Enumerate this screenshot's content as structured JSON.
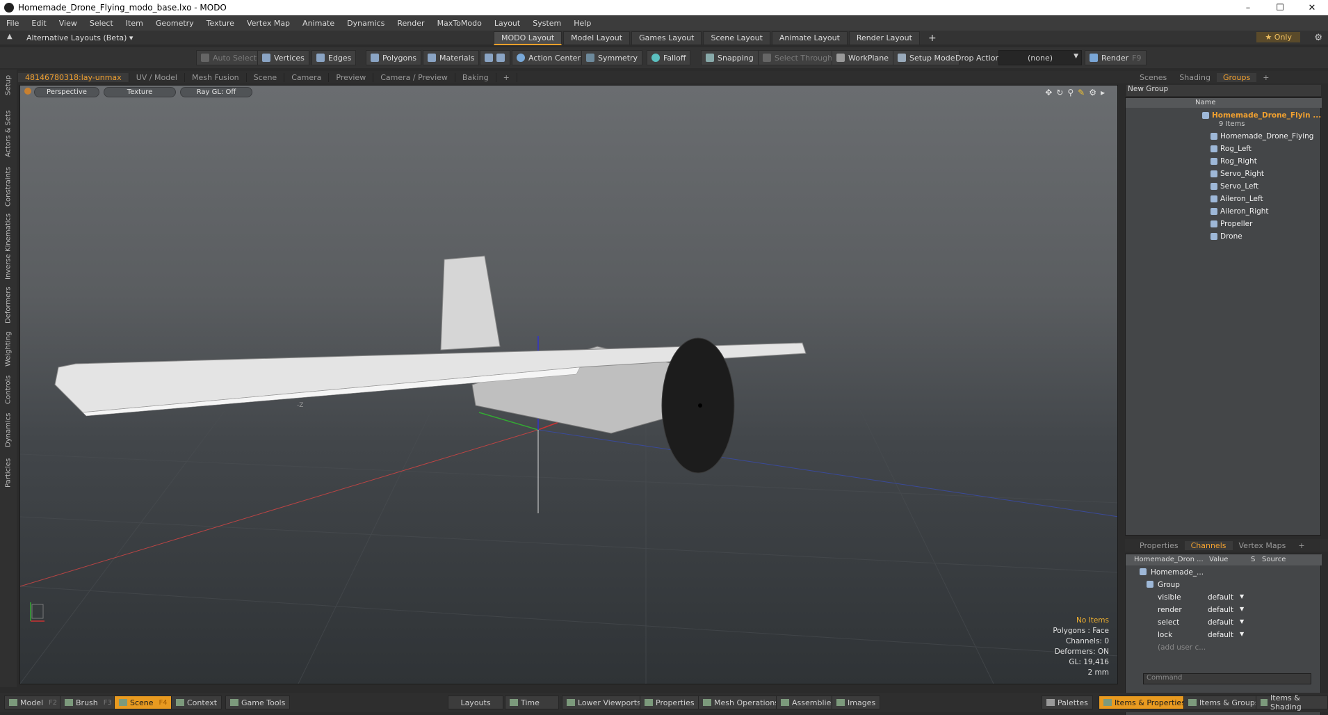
{
  "window": {
    "title": "Homemade_Drone_Flying_modo_base.lxo - MODO",
    "buttons": [
      "–",
      "☐",
      "✕"
    ]
  },
  "menu": [
    "File",
    "Edit",
    "View",
    "Select",
    "Item",
    "Geometry",
    "Texture",
    "Vertex Map",
    "Animate",
    "Dynamics",
    "Render",
    "MaxToModo",
    "Layout",
    "System",
    "Help"
  ],
  "layout_bar": {
    "alt_layouts": "Alternative Layouts (Beta) ▾",
    "tabs": [
      "MODO Layout",
      "Model Layout",
      "Games Layout",
      "Scene Layout",
      "Animate Layout",
      "Render Layout"
    ],
    "add": "+",
    "only": "★ Only"
  },
  "toolbar": {
    "auto_select": "Auto Select",
    "vertices": "Vertices",
    "edges": "Edges",
    "polygons": "Polygons",
    "materials": "Materials",
    "action_center": "Action Center",
    "symmetry": "Symmetry",
    "falloff": "Falloff",
    "snapping": "Snapping",
    "select_through": "Select Through",
    "workplane": "WorkPlane",
    "setup_mode": "Setup Mode",
    "drop_action": "Drop Action",
    "drop_value": "(none)",
    "render": "Render",
    "render_key": "F9"
  },
  "left_tabs": [
    "Setup",
    "Actors & Sets",
    "Constraints",
    "Inverse Kinematics",
    "Deformers",
    "Weighting",
    "Controls",
    "Dynamics",
    "Particles"
  ],
  "viewport_tabs": {
    "items": [
      "48146780318:lay-unmax",
      "UV / Model",
      "Mesh Fusion",
      "Scene",
      "Camera",
      "Preview",
      "Camera / Preview",
      "Baking",
      "+"
    ],
    "active": 0
  },
  "viewport": {
    "perspective": "Perspective",
    "texture": "Texture",
    "raygl": "Ray GL: Off",
    "axis_label": "-Z",
    "info": {
      "no_items": "No Items",
      "polygons": "Polygons : Face",
      "channels": "Channels: 0",
      "deformers": "Deformers: ON",
      "gl": "GL: 19,416",
      "unit": "2 mm"
    }
  },
  "scene_panel": {
    "tabs": [
      "Scenes",
      "Shading",
      "Groups",
      "+"
    ],
    "active_tab": "Groups",
    "new_group": "New Group",
    "name_header": "Name",
    "group_name": "Homemade_Drone_Flyin ...",
    "item_count": "9 Items",
    "items": [
      "Homemade_Drone_Flying",
      "Rog_Left",
      "Rog_Right",
      "Servo_Right",
      "Servo_Left",
      "Aileron_Left",
      "Aileron_Right",
      "Propeller",
      "Drone"
    ]
  },
  "channels_panel": {
    "tabs": [
      "Properties",
      "Channels",
      "Vertex Maps",
      "+"
    ],
    "active_tab": "Channels",
    "headers": {
      "name": "Homemade_Dron ...",
      "value": "Value",
      "s": "S",
      "source": "Source"
    },
    "root": "Homemade_...",
    "group": "Group",
    "rows": [
      {
        "name": "visible",
        "value": "default"
      },
      {
        "name": "render",
        "value": "default"
      },
      {
        "name": "select",
        "value": "default"
      },
      {
        "name": "lock",
        "value": "default"
      }
    ],
    "add_user": "(add user c...",
    "command_placeholder": "Command"
  },
  "bottom_bar": {
    "model": "Model",
    "model_key": "F2",
    "brush": "Brush",
    "brush_key": "F3",
    "scene": "Scene",
    "scene_key": "F4",
    "context": "Context",
    "game_tools": "Game Tools",
    "layouts": "Layouts",
    "time": "Time",
    "lower_viewports": "Lower Viewports",
    "properties": "Properties",
    "mesh_operations": "Mesh Operations",
    "assemblies": "Assemblies",
    "images": "Images",
    "palettes": "Palettes",
    "items_properties": "Items & Properties",
    "items_groups": "Items & Groups",
    "items_shading": "Items & Shading"
  },
  "colors": {
    "accent": "#f0a030",
    "highlight": "#e89a20"
  }
}
